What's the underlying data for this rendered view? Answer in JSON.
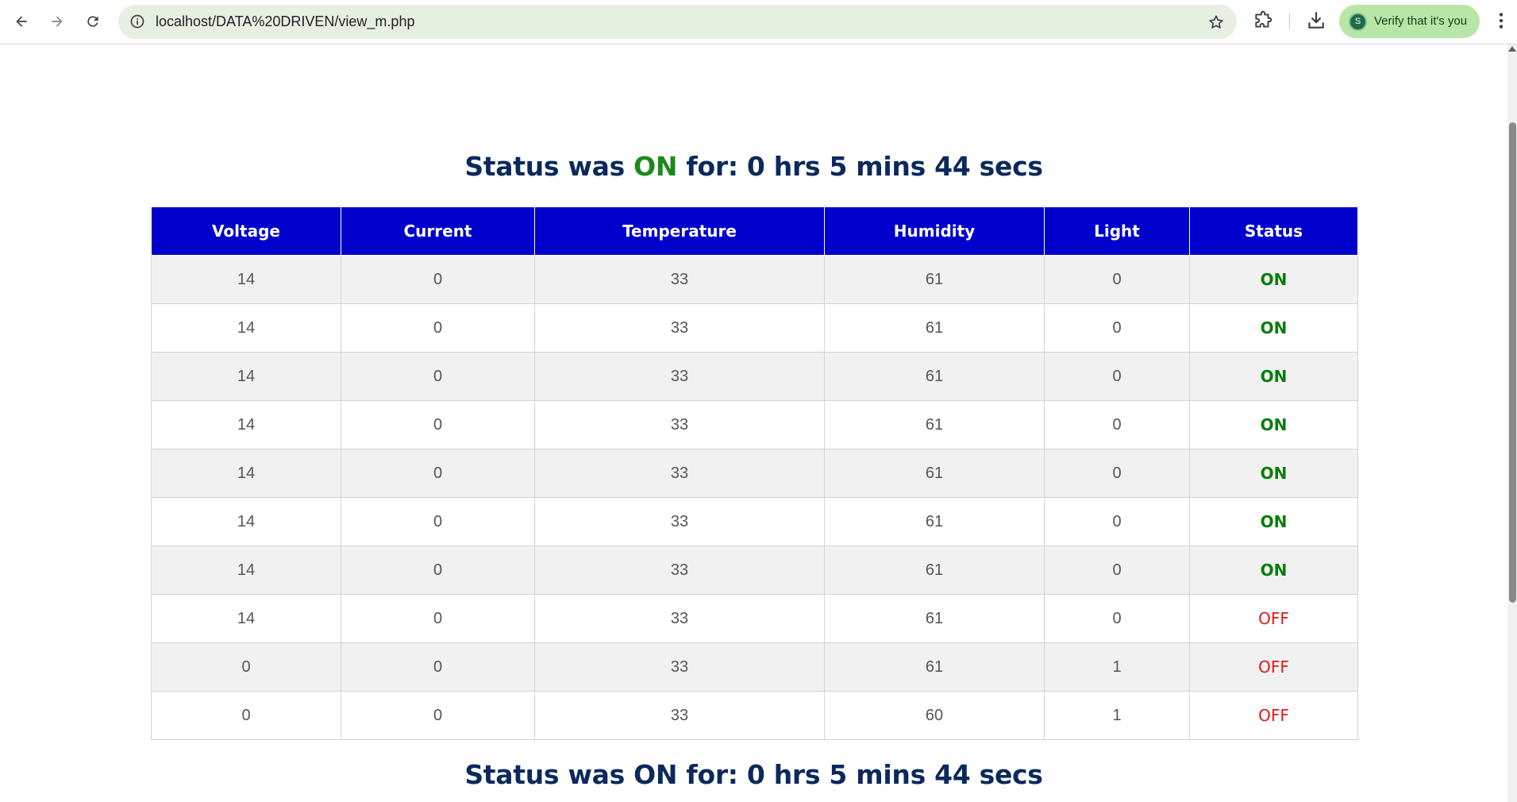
{
  "browser": {
    "url": "localhost/DATA%20DRIVEN/view_m.php",
    "verify_label": "Verify that it's you",
    "avatar_letter": "S",
    "icons": {
      "back": "back-arrow-icon",
      "forward": "forward-arrow-icon",
      "reload": "reload-icon",
      "site_info": "site-info-icon",
      "bookmark": "star-icon",
      "extensions": "puzzle-icon",
      "downloads": "download-icon",
      "menu": "kebab-menu-icon"
    }
  },
  "summary_top": {
    "prefix": "Status was",
    "state": "ON",
    "suffix": "for: 0 hrs 5 mins 44 secs"
  },
  "summary_bottom": {
    "text": "Status was ON for: 0 hrs 5 mins 44 secs"
  },
  "colors": {
    "header_bg": "#0000cc",
    "on": "#0a7d0a",
    "off": "#e0181b",
    "heading": "#0b2a5b"
  },
  "table": {
    "columns": [
      "Voltage",
      "Current",
      "Temperature",
      "Humidity",
      "Light",
      "Status"
    ],
    "rows": [
      [
        "14",
        "0",
        "33",
        "61",
        "0",
        "ON"
      ],
      [
        "14",
        "0",
        "33",
        "61",
        "0",
        "ON"
      ],
      [
        "14",
        "0",
        "33",
        "61",
        "0",
        "ON"
      ],
      [
        "14",
        "0",
        "33",
        "61",
        "0",
        "ON"
      ],
      [
        "14",
        "0",
        "33",
        "61",
        "0",
        "ON"
      ],
      [
        "14",
        "0",
        "33",
        "61",
        "0",
        "ON"
      ],
      [
        "14",
        "0",
        "33",
        "61",
        "0",
        "ON"
      ],
      [
        "14",
        "0",
        "33",
        "61",
        "0",
        "OFF"
      ],
      [
        "0",
        "0",
        "33",
        "61",
        "1",
        "OFF"
      ],
      [
        "0",
        "0",
        "33",
        "60",
        "1",
        "OFF"
      ]
    ]
  }
}
